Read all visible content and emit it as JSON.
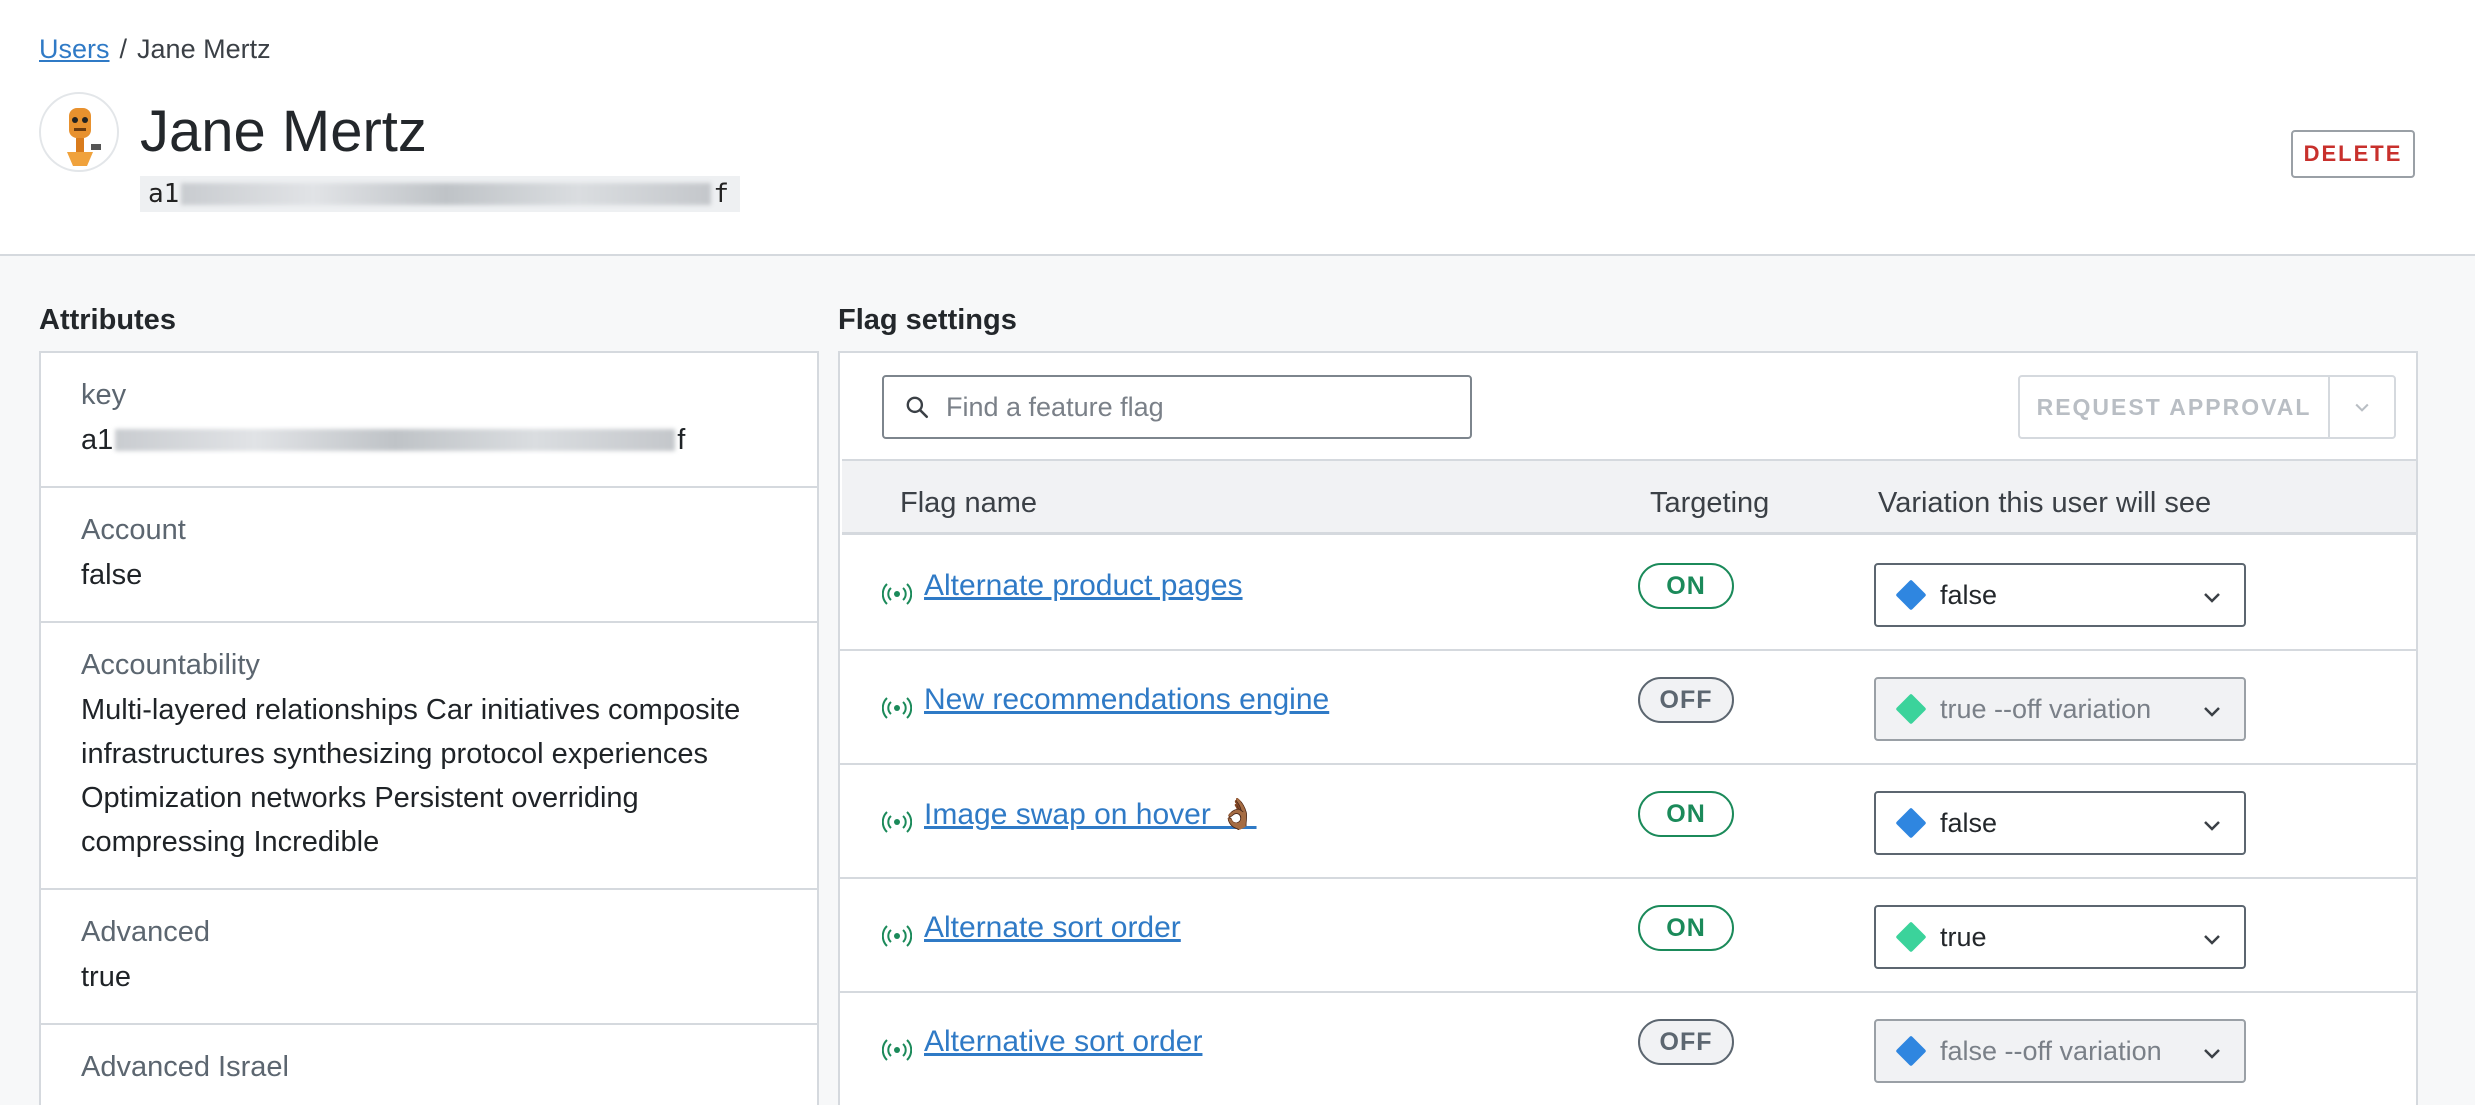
{
  "breadcrumb": {
    "parent": "Users",
    "separator": "/",
    "current": "Jane Mertz"
  },
  "user": {
    "name": "Jane Mertz",
    "id_prefix": "a1",
    "id_suffix": "f"
  },
  "header": {
    "delete_label": "DELETE"
  },
  "attributes": {
    "title": "Attributes",
    "items": [
      {
        "key": "key",
        "value_prefix": "a1",
        "value_suffix": "f",
        "redacted": true
      },
      {
        "key": "Account",
        "value": "false"
      },
      {
        "key": "Accountability",
        "value": "Multi-layered relationships Car initiatives composite infrastructures synthesizing protocol experiences Optimization networks Persistent overriding compressing Incredible"
      },
      {
        "key": "Advanced",
        "value": "true"
      },
      {
        "key": "Advanced Israel",
        "value": ""
      }
    ]
  },
  "flags": {
    "title": "Flag settings",
    "search_placeholder": "Find a feature flag",
    "request_approval_label": "REQUEST APPROVAL",
    "columns": {
      "name": "Flag name",
      "targeting": "Targeting",
      "variation": "Variation this user will see"
    },
    "rows": [
      {
        "name": "Alternate product pages",
        "targeting": "ON",
        "variation": "false",
        "color": "#2f86e0",
        "disabled": false
      },
      {
        "name": "New recommendations engine",
        "targeting": "OFF",
        "variation": "true --off variation",
        "color": "#3bd39b",
        "disabled": true
      },
      {
        "name": "Image swap on hover 👌🏾",
        "targeting": "ON",
        "variation": "false",
        "color": "#2f86e0",
        "disabled": false
      },
      {
        "name": "Alternate sort order",
        "targeting": "ON",
        "variation": "true",
        "color": "#3bd39b",
        "disabled": false
      },
      {
        "name": "Alternative sort order",
        "targeting": "OFF",
        "variation": "false --off variation",
        "color": "#2f86e0",
        "disabled": true
      }
    ]
  },
  "colors": {
    "link": "#2f7ac6",
    "on": "#1b8a5a",
    "delete": "#c8302c"
  },
  "icons": {
    "search": "search-icon",
    "flag": "broadcast-icon",
    "chevron": "chevron-down-icon"
  }
}
